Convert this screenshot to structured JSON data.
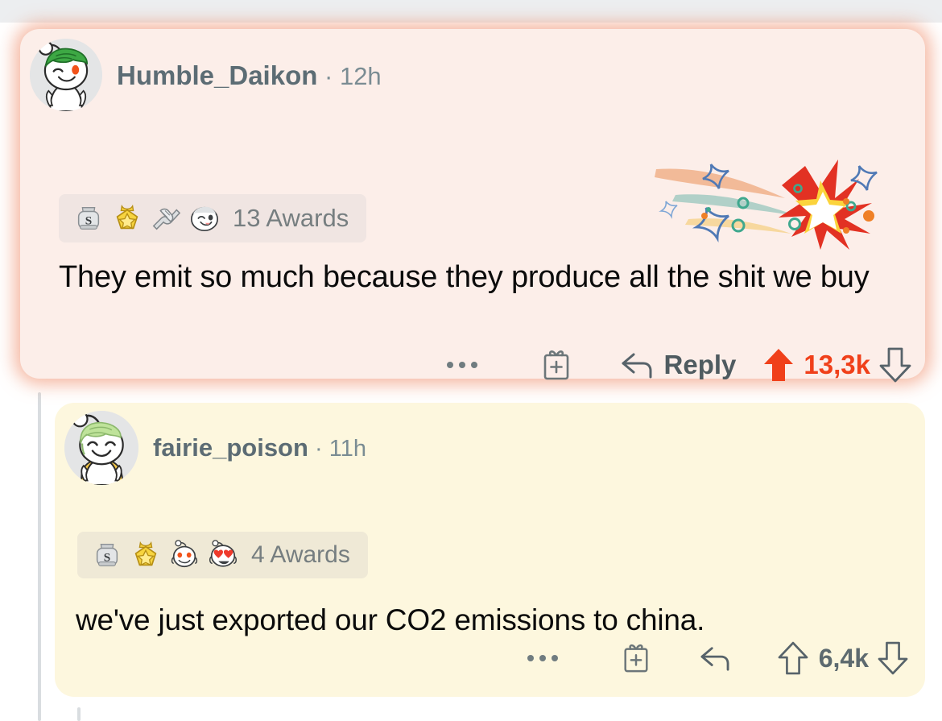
{
  "window": {
    "top_strip_color": "#eceef0",
    "background_color": "#ffffff"
  },
  "theme": {
    "card_pink": "#fceee9",
    "card_cream": "#fdf7de",
    "glow_orange": "#ec7c54",
    "upvote_orange": "#f0401a",
    "username_gray": "#5c6c74",
    "meta_gray": "#7a8c93",
    "awards_pill_pink": "#f0e5e2",
    "awards_pill_cream": "#efe9d6",
    "thread_line_gray": "#d9dde0",
    "body_text": "#0b0b0b"
  },
  "comments": [
    {
      "id": "comment-0",
      "author": "Humble_Daikon",
      "separator": "·",
      "timestamp": "12h",
      "avatar_alt": "snoo-avatar-green-hair-winking",
      "awards": {
        "count_label": "13 Awards",
        "icons": [
          "silver-medal-award",
          "gold-star-medal-award",
          "arm-wrestle-award",
          "snoo-smirk-award"
        ]
      },
      "body": "They emit so much because they produce all the shit we buy",
      "actions": {
        "overflow_label": "…",
        "gift_label": "gift-award",
        "reply_label": "Reply",
        "upvote_label": "upvote",
        "downvote_label": "downvote",
        "score": "13,3k",
        "upvoted": true,
        "has_reply_text": true
      },
      "decoration": "award-burst-shooting-star"
    },
    {
      "id": "comment-1",
      "author": "fairie_poison",
      "separator": "·",
      "timestamp": "11h",
      "avatar_alt": "snoo-avatar-light-green-hair-smiling",
      "awards": {
        "count_label": "4 Awards",
        "icons": [
          "silver-medal-award",
          "gold-star-medal-award",
          "snoo-face-award",
          "snoo-heart-eyes-award"
        ]
      },
      "body": "we've just exported our CO2 emissions to china.",
      "actions": {
        "overflow_label": "…",
        "gift_label": "gift-award",
        "reply_label": "",
        "upvote_label": "upvote",
        "downvote_label": "downvote",
        "score": "6,4k",
        "upvoted": false,
        "has_reply_text": false
      },
      "decoration": ""
    }
  ]
}
